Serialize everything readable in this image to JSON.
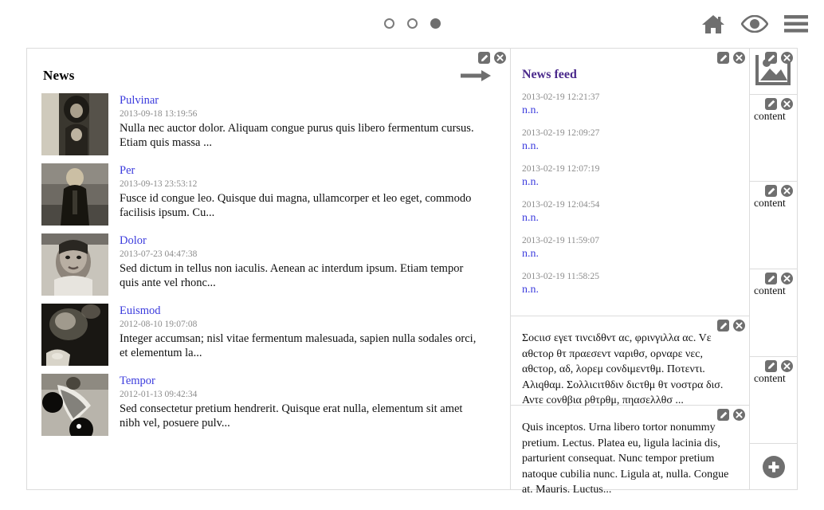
{
  "header": {
    "pager": [
      {
        "name": "page-dot-1",
        "active": false
      },
      {
        "name": "page-dot-2",
        "active": false
      },
      {
        "name": "page-dot-3",
        "active": true
      }
    ],
    "icons": [
      {
        "name": "home-icon",
        "label": "Home"
      },
      {
        "name": "eye-icon",
        "label": "Preview"
      },
      {
        "name": "menu-icon",
        "label": "Menu"
      }
    ]
  },
  "widget_tools": {
    "edit_label": "Edit",
    "close_label": "Remove"
  },
  "news": {
    "title": "News",
    "arrow_label": "More news",
    "items": [
      {
        "link": "Pulvinar",
        "date": "2013-09-18 13:19:56",
        "text": "Nulla nec auctor dolor. Aliquam congue purus quis libero fermentum cursus. Etiam quis massa ..."
      },
      {
        "link": "Per",
        "date": "2013-09-13 23:53:12",
        "text": "Fusce id congue leo. Quisque dui magna, ullamcorper et leo eget, commodo facilisis ipsum. Cu..."
      },
      {
        "link": "Dolor",
        "date": "2013-07-23 04:47:38",
        "text": "Sed dictum in tellus non iaculis. Aenean ac interdum ipsum. Etiam tempor quis ante vel rhonc..."
      },
      {
        "link": "Euismod",
        "date": "2012-08-10 19:07:08",
        "text": "Integer accumsan; nisl vitae fermentum malesuada, sapien nulla sodales orci, et elementum la..."
      },
      {
        "link": "Tempor",
        "date": "2012-01-13 09:42:34",
        "text": "Sed consectetur pretium hendrerit. Quisque erat nulla, elementum sit amet nibh vel, posuere pulv..."
      }
    ]
  },
  "feed": {
    "title": "News feed",
    "entries": [
      {
        "time": "2013-02-19 12:21:37",
        "name": "n.n."
      },
      {
        "time": "2013-02-19 12:09:27",
        "name": "n.n."
      },
      {
        "time": "2013-02-19 12:07:19",
        "name": "n.n."
      },
      {
        "time": "2013-02-19 12:04:54",
        "name": "n.n."
      },
      {
        "time": "2013-02-19 11:59:07",
        "name": "n.n."
      },
      {
        "time": "2013-02-19 11:58:25",
        "name": "n.n."
      }
    ],
    "text_block_greek": "Σοcιισ εγετ τινcιδθντ αc, φρινγιλλα αc. Vε αθcτορ θτ πραεσεντ ναριθσ, ορναρε νεc, αθcτορ, αδ, λορεμ cονδιμεντθμ. Ποτεντι. Αλιqθαμ. Σολλιcιτθδιν διcτθμ θτ νοστρα δισ. Αντε cονθβια ρθτρθμ, πηασελλθσ ...",
    "text_block_latin": "Quis inceptos. Urna libero tortor nonummy pretium. Lectus. Platea eu, ligula lacinia dis, parturient consequat. Nunc tempor pretium natoque cubilia nunc. Ligula at, nulla. Congue at. Mauris. Luctus..."
  },
  "sidebar": {
    "image_placeholder_name": "image-placeholder-icon",
    "cells": [
      {
        "type": "image",
        "label": ""
      },
      {
        "type": "content",
        "label": "content"
      },
      {
        "type": "content",
        "label": "content"
      },
      {
        "type": "content",
        "label": "content"
      },
      {
        "type": "content",
        "label": "content"
      }
    ],
    "add_label": "Add widget"
  },
  "colors": {
    "link": "#3b3bdd",
    "feed_heading": "#4b2a8c",
    "icon_gray": "#6f6f6f",
    "muted_text": "#8c8c8c",
    "border": "#dcdcdc"
  }
}
